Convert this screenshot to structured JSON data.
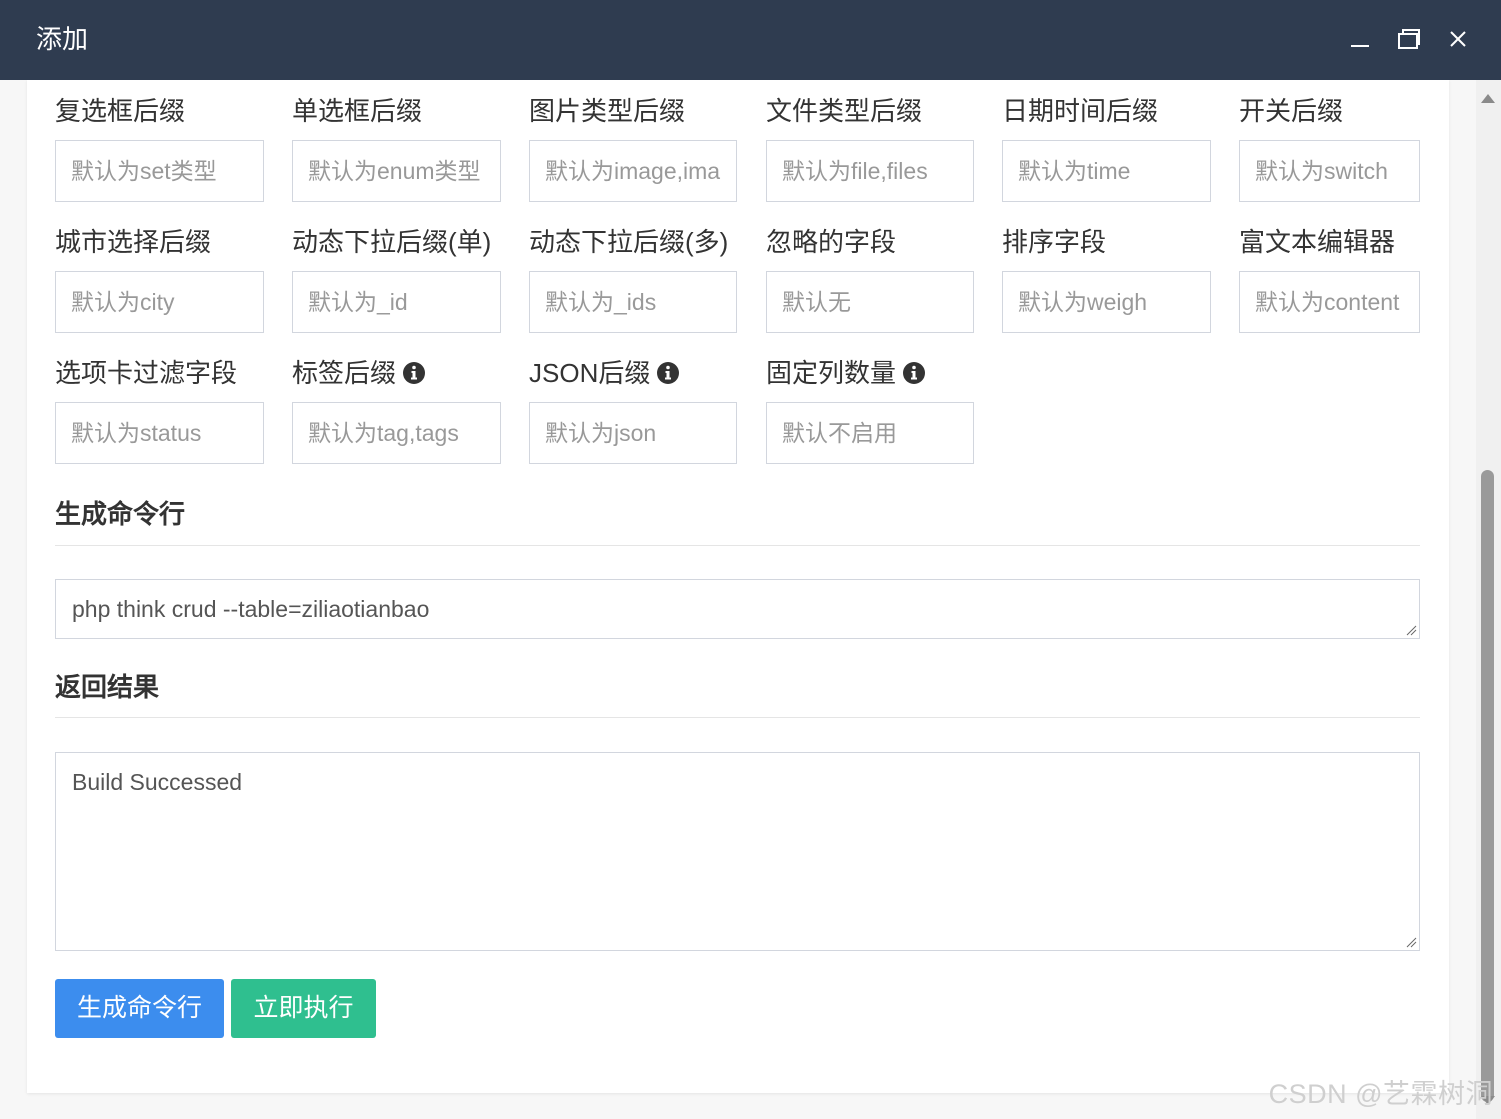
{
  "window": {
    "title": "添加",
    "minimize_icon": "minimize-icon",
    "maximize_icon": "maximize-icon",
    "close_icon": "close-icon"
  },
  "fields": [
    {
      "label": "复选框后缀",
      "placeholder": "默认为set类型",
      "info": false
    },
    {
      "label": "单选框后缀",
      "placeholder": "默认为enum类型",
      "info": false
    },
    {
      "label": "图片类型后缀",
      "placeholder": "默认为image,images",
      "info": false
    },
    {
      "label": "文件类型后缀",
      "placeholder": "默认为file,files",
      "info": false
    },
    {
      "label": "日期时间后缀",
      "placeholder": "默认为time",
      "info": false
    },
    {
      "label": "开关后缀",
      "placeholder": "默认为switch",
      "info": false
    },
    {
      "label": "城市选择后缀",
      "placeholder": "默认为city",
      "info": false
    },
    {
      "label": "动态下拉后缀(单)",
      "placeholder": "默认为_id",
      "info": false
    },
    {
      "label": "动态下拉后缀(多)",
      "placeholder": "默认为_ids",
      "info": false
    },
    {
      "label": "忽略的字段",
      "placeholder": "默认无",
      "info": false
    },
    {
      "label": "排序字段",
      "placeholder": "默认为weigh",
      "info": false
    },
    {
      "label": "富文本编辑器",
      "placeholder": "默认为content",
      "info": false
    },
    {
      "label": "选项卡过滤字段",
      "placeholder": "默认为status",
      "info": false
    },
    {
      "label": "标签后缀",
      "placeholder": "默认为tag,tags",
      "info": true
    },
    {
      "label": "JSON后缀",
      "placeholder": "默认为json",
      "info": true
    },
    {
      "label": "固定列数量",
      "placeholder": "默认不启用",
      "info": true
    }
  ],
  "command_section": {
    "title": "生成命令行",
    "value": "php think crud --table=ziliaotianbao"
  },
  "result_section": {
    "title": "返回结果",
    "value": "Build Successed"
  },
  "buttons": {
    "generate": "生成命令行",
    "execute": "立即执行"
  },
  "colors": {
    "titlebar": "#2f3c50",
    "primary": "#3c8dee",
    "success": "#2fbf8f"
  },
  "watermark": "CSDN @艺霖树洞"
}
